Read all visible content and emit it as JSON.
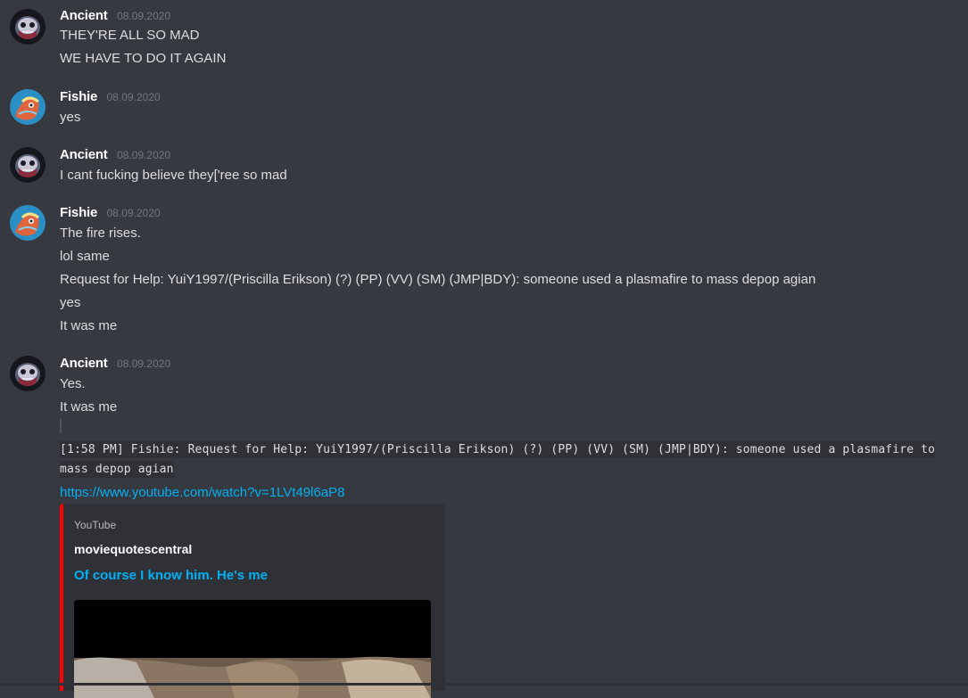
{
  "messages": [
    {
      "author": "Ancient",
      "timestamp": "08.09.2020",
      "lines": [
        "THEY'RE ALL SO MAD",
        "WE HAVE TO DO IT AGAIN"
      ]
    },
    {
      "author": "Fishie",
      "timestamp": "08.09.2020",
      "lines": [
        "yes"
      ]
    },
    {
      "author": "Ancient",
      "timestamp": "08.09.2020",
      "lines": [
        "I cant fucking believe they['ree so mad"
      ]
    },
    {
      "author": "Fishie",
      "timestamp": "08.09.2020",
      "lines": [
        "The fire rises.",
        "lol same",
        "Request for Help: YuiY1997/(Priscilla Erikson) (?) (PP) (VV) (SM) (JMP|BDY): someone used a plasmafire to mass depop agian",
        "yes",
        "It was me"
      ]
    },
    {
      "author": "Ancient",
      "timestamp": "08.09.2020",
      "lines": [
        "Yes.",
        "It was me"
      ],
      "code_lines": [
        "[1:58 PM] Fishie: Request for Help: YuiY1997/(Priscilla Erikson) (?) (PP) (VV) (SM) (JMP|BDY): someone used a plasmafire to",
        "mass depop agian"
      ],
      "link": "https://www.youtube.com/watch?v=1LVt49l6aP8",
      "embed": {
        "provider": "YouTube",
        "author": "moviequotescentral",
        "title": "Of course I know him. He's me"
      }
    }
  ],
  "colors": {
    "background": "#36393f",
    "username": "#ffffff",
    "timestamp": "#72767d",
    "link": "#00b0f4",
    "embed_border": "#ff0000",
    "embed_background": "#2f3136"
  },
  "icons": {
    "ancient_avatar": "ancient-avatar",
    "fishie_avatar": "fishie-avatar"
  }
}
